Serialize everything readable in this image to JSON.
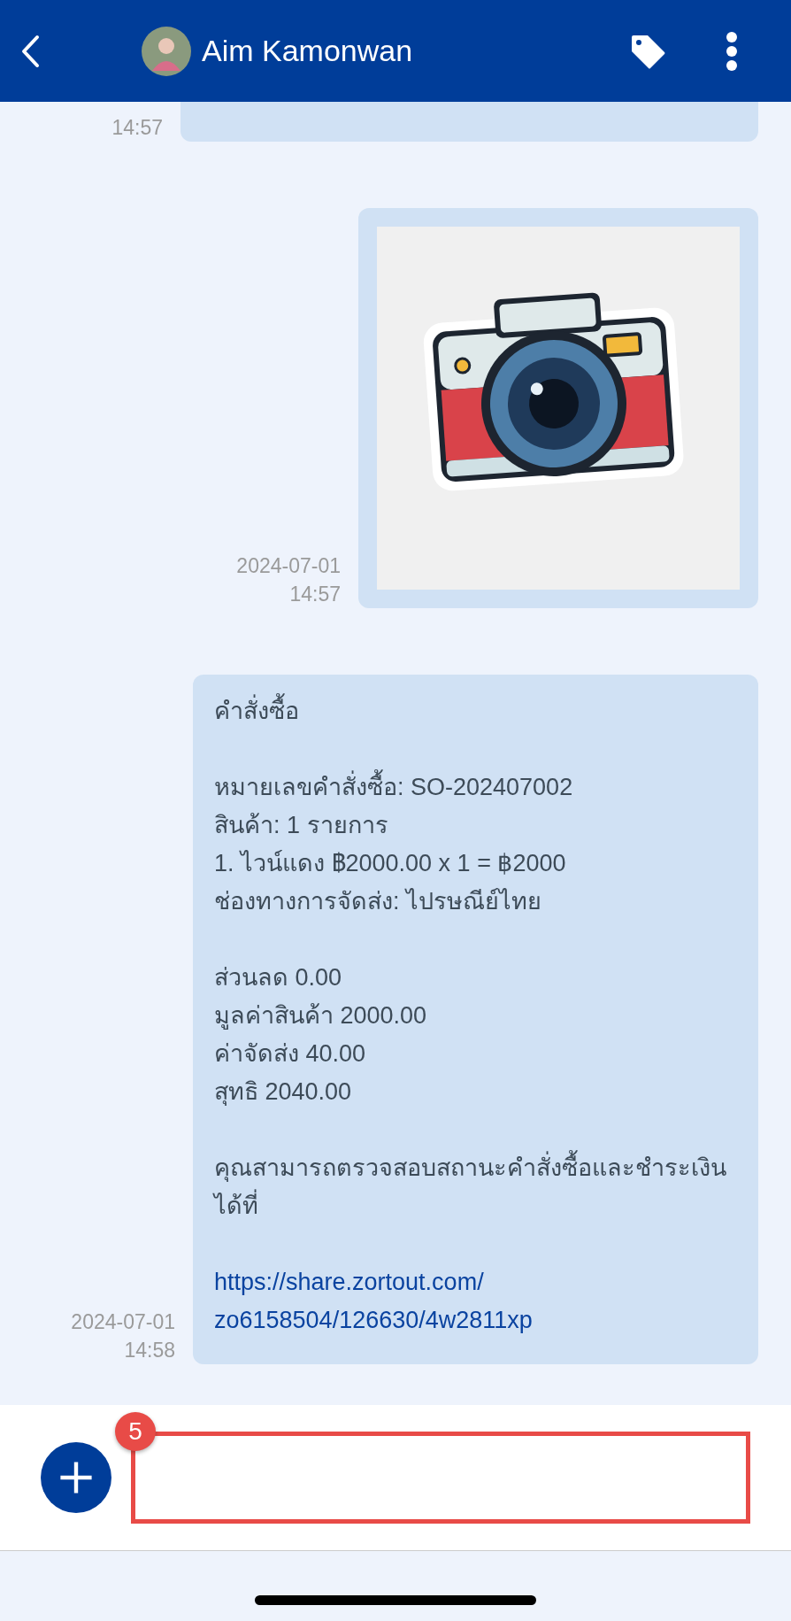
{
  "header": {
    "title": "Aim Kamonwan"
  },
  "messages": [
    {
      "kind": "cut",
      "time": "14:57"
    },
    {
      "kind": "image",
      "date": "2024-07-01",
      "time": "14:57"
    },
    {
      "kind": "order",
      "date": "2024-07-01",
      "time": "14:58",
      "paragraphs": [
        {
          "lines": [
            "คำสั่งซื้อ"
          ]
        },
        {
          "lines": [
            "หมายเลขคำสั่งซื้อ: SO-202407002",
            "สินค้า: 1 รายการ",
            "1. ไวน์แดง ฿2000.00 x 1 = ฿2000",
            "ช่องทางการจัดส่ง: ไปรษณีย์ไทย"
          ]
        },
        {
          "lines": [
            "ส่วนลด 0.00",
            "มูลค่าสินค้า 2000.00",
            "ค่าจัดส่ง 40.00",
            "สุทธิ 2040.00"
          ]
        },
        {
          "lines": [
            "คุณสามารถตรวจสอบสถานะคำสั่งซื้อและชำระเงินได้ที่"
          ]
        }
      ],
      "link_lines": [
        "https://share.zortout.com/",
        "zo6158504/126630/4w2811xp"
      ]
    }
  ],
  "composer": {
    "badge": "5",
    "highlighted": true
  }
}
